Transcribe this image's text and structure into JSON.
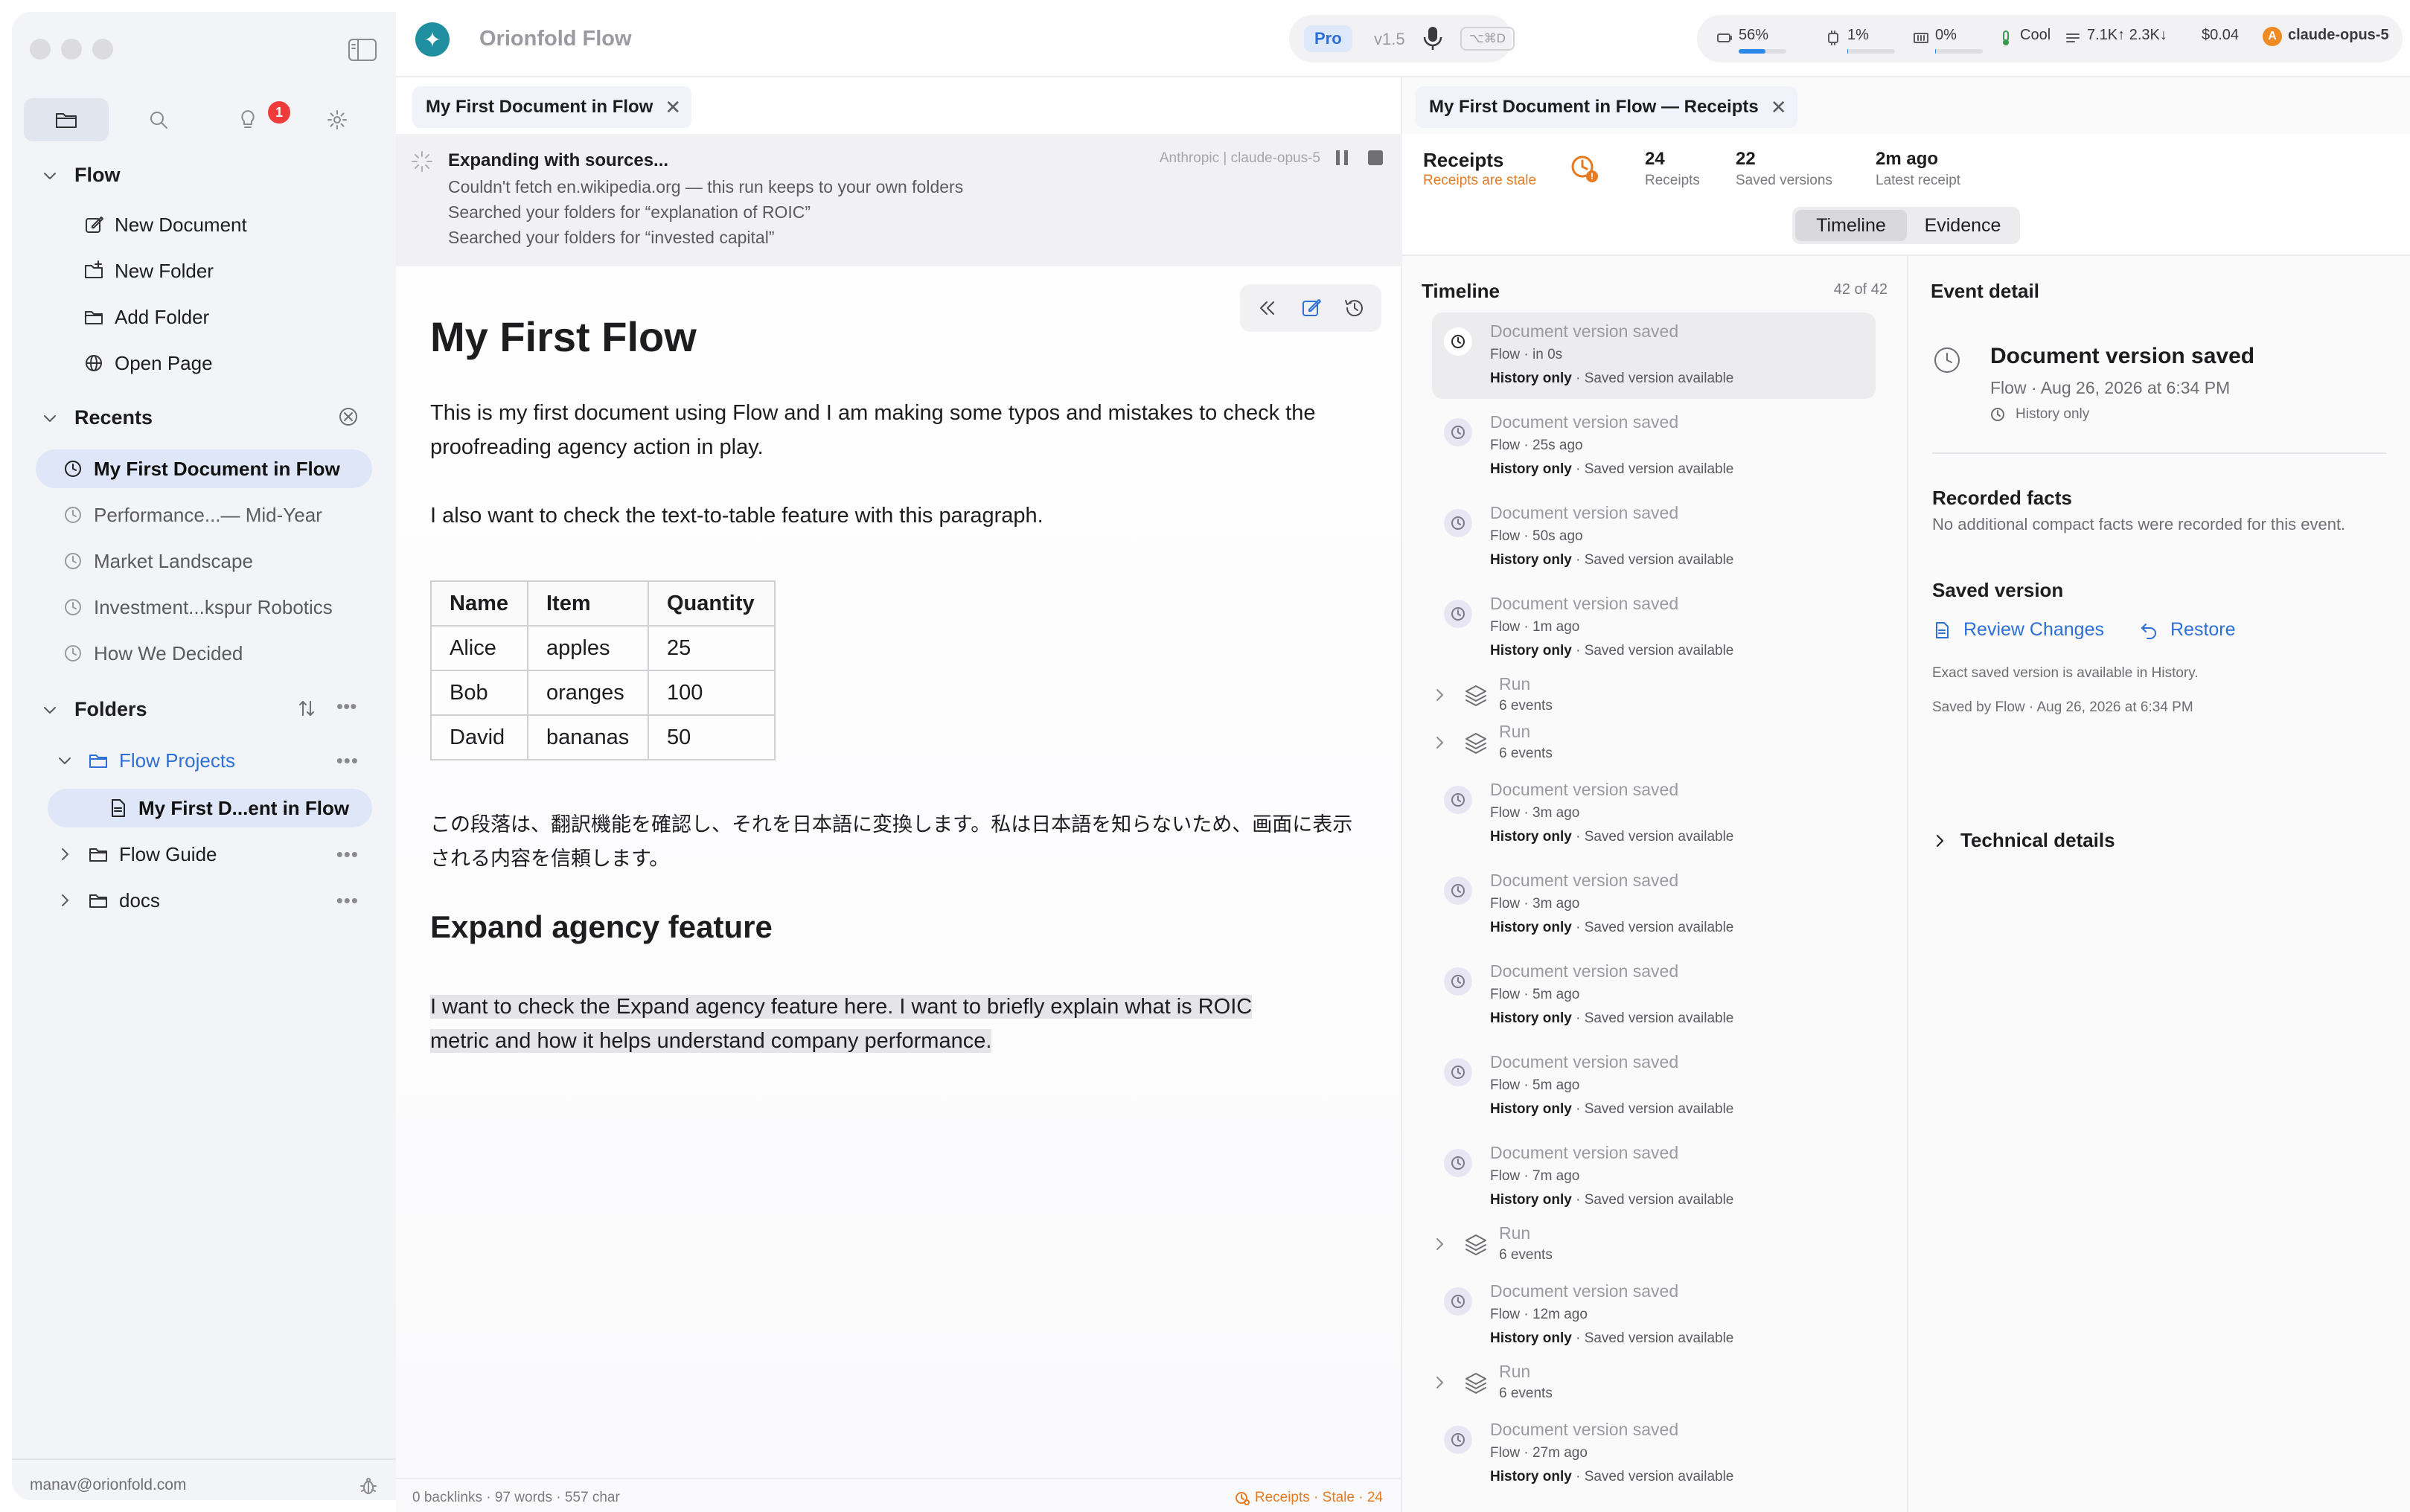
{
  "app": {
    "title": "Orionfold Flow",
    "plan": "Pro",
    "version": "v1.5",
    "shortcut": "⌥⌘D"
  },
  "stats": {
    "context_pct": "56%",
    "context_fill": 0.56,
    "cpu": "1%",
    "memory": "0%",
    "thermal": "Cool",
    "tokens": "7.1K↑ 2.3K↓",
    "cost": "$0.04",
    "model": "claude-opus-5",
    "model_initial": "A"
  },
  "sidebar": {
    "badge_count": "1",
    "flow_section": "Flow",
    "flow_items": [
      {
        "label": "New Document",
        "icon": "compose-icon"
      },
      {
        "label": "New Folder",
        "icon": "folder-plus-icon"
      },
      {
        "label": "Add Folder",
        "icon": "folder-icon"
      },
      {
        "label": "Open Page",
        "icon": "globe-icon"
      }
    ],
    "recents_section": "Recents",
    "recents": [
      "My First Document in Flow",
      "Performance...— Mid-Year",
      "Market Landscape",
      "Investment...kspur Robotics",
      "How We Decided"
    ],
    "folders_section": "Folders",
    "folders": [
      {
        "label": "Flow Projects"
      },
      {
        "label": "My First D...ent in Flow"
      },
      {
        "label": "Flow Guide"
      },
      {
        "label": "docs"
      }
    ],
    "footer_email": "manav@orionfold.com"
  },
  "editor": {
    "tab_label": "My First Document in Flow",
    "banner": {
      "title": "Expanding with sources...",
      "lines": [
        "Couldn't fetch en.wikipedia.org — this run keeps to your own folders",
        "Searched your folders for “explanation of ROIC”",
        "Searched your folders for “invested capital”"
      ],
      "model": "Anthropic | claude-opus-5"
    },
    "doc_title": "My First Flow",
    "para1": "This is my first document using Flow and I am making some typos and mistakes to check the proofreading agency action in play.",
    "para2": "I also want to check the text-to-table feature with this paragraph.",
    "table": {
      "headers": [
        "Name",
        "Item",
        "Quantity"
      ],
      "rows": [
        [
          "Alice",
          "apples",
          "25"
        ],
        [
          "Bob",
          "oranges",
          "100"
        ],
        [
          "David",
          "bananas",
          "50"
        ]
      ]
    },
    "para3": "この段落は、翻訳機能を確認し、それを日本語に変換します。私は日本語を知らないため、画面に表示される内容を信頼します。",
    "heading2": "Expand agency feature",
    "para4_line1": "I want to check the Expand agency feature here. I want to briefly explain what is ROIC",
    "para4_line2": "metric and how it helps understand company performance.",
    "status_left": "0 backlinks · 97 words · 557 char",
    "status_right": "Receipts · Stale · 24"
  },
  "receipts": {
    "tab_label": "My First Document in Flow — Receipts",
    "label": "Receipts",
    "stale": "Receipts are stale",
    "metrics": [
      {
        "value": "24",
        "label": "Receipts"
      },
      {
        "value": "22",
        "label": "Saved versions"
      },
      {
        "value": "2m ago",
        "label": "Latest receipt"
      }
    ],
    "segments": [
      "Timeline",
      "Evidence"
    ],
    "timeline_title": "Timeline",
    "timeline_count": "42 of 42",
    "events": [
      {
        "kind": "event",
        "title": "Document version saved",
        "meta": "Flow  ·  in 0s",
        "hist": "History only",
        "avail": " · Saved version available",
        "selected": true
      },
      {
        "kind": "event",
        "title": "Document version saved",
        "meta": "Flow  ·  25s ago",
        "hist": "History only",
        "avail": " · Saved version available"
      },
      {
        "kind": "event",
        "title": "Document version saved",
        "meta": "Flow  ·  50s ago",
        "hist": "History only",
        "avail": " · Saved version available"
      },
      {
        "kind": "event",
        "title": "Document version saved",
        "meta": "Flow  ·  1m ago",
        "hist": "History only",
        "avail": " · Saved version available"
      },
      {
        "kind": "run",
        "title": "Run",
        "meta": "6 events"
      },
      {
        "kind": "run",
        "title": "Run",
        "meta": "6 events"
      },
      {
        "kind": "event",
        "title": "Document version saved",
        "meta": "Flow  ·  3m ago",
        "hist": "History only",
        "avail": " · Saved version available"
      },
      {
        "kind": "event",
        "title": "Document version saved",
        "meta": "Flow  ·  3m ago",
        "hist": "History only",
        "avail": " · Saved version available"
      },
      {
        "kind": "event",
        "title": "Document version saved",
        "meta": "Flow  ·  5m ago",
        "hist": "History only",
        "avail": " · Saved version available"
      },
      {
        "kind": "event",
        "title": "Document version saved",
        "meta": "Flow  ·  5m ago",
        "hist": "History only",
        "avail": " · Saved version available"
      },
      {
        "kind": "event",
        "title": "Document version saved",
        "meta": "Flow  ·  7m ago",
        "hist": "History only",
        "avail": " · Saved version available"
      },
      {
        "kind": "run",
        "title": "Run",
        "meta": "6 events"
      },
      {
        "kind": "event",
        "title": "Document version saved",
        "meta": "Flow  ·  12m ago",
        "hist": "History only",
        "avail": " · Saved version available"
      },
      {
        "kind": "run",
        "title": "Run",
        "meta": "6 events"
      },
      {
        "kind": "event",
        "title": "Document version saved",
        "meta": "Flow  ·  27m ago",
        "hist": "History only",
        "avail": " · Saved version available"
      }
    ],
    "detail": {
      "title": "Event detail",
      "event_name": "Document version saved",
      "event_meta": "Flow · Aug 26, 2026 at 6:34 PM",
      "history": "History only",
      "facts_heading": "Recorded facts",
      "facts_text": "No additional compact facts were recorded for this event.",
      "saved_heading": "Saved version",
      "review_label": "Review Changes",
      "restore_label": "Restore",
      "note1": "Exact saved version is available in History.",
      "note2": "Saved by Flow · Aug 26, 2026 at 6:34 PM",
      "technical": "Technical details"
    }
  }
}
